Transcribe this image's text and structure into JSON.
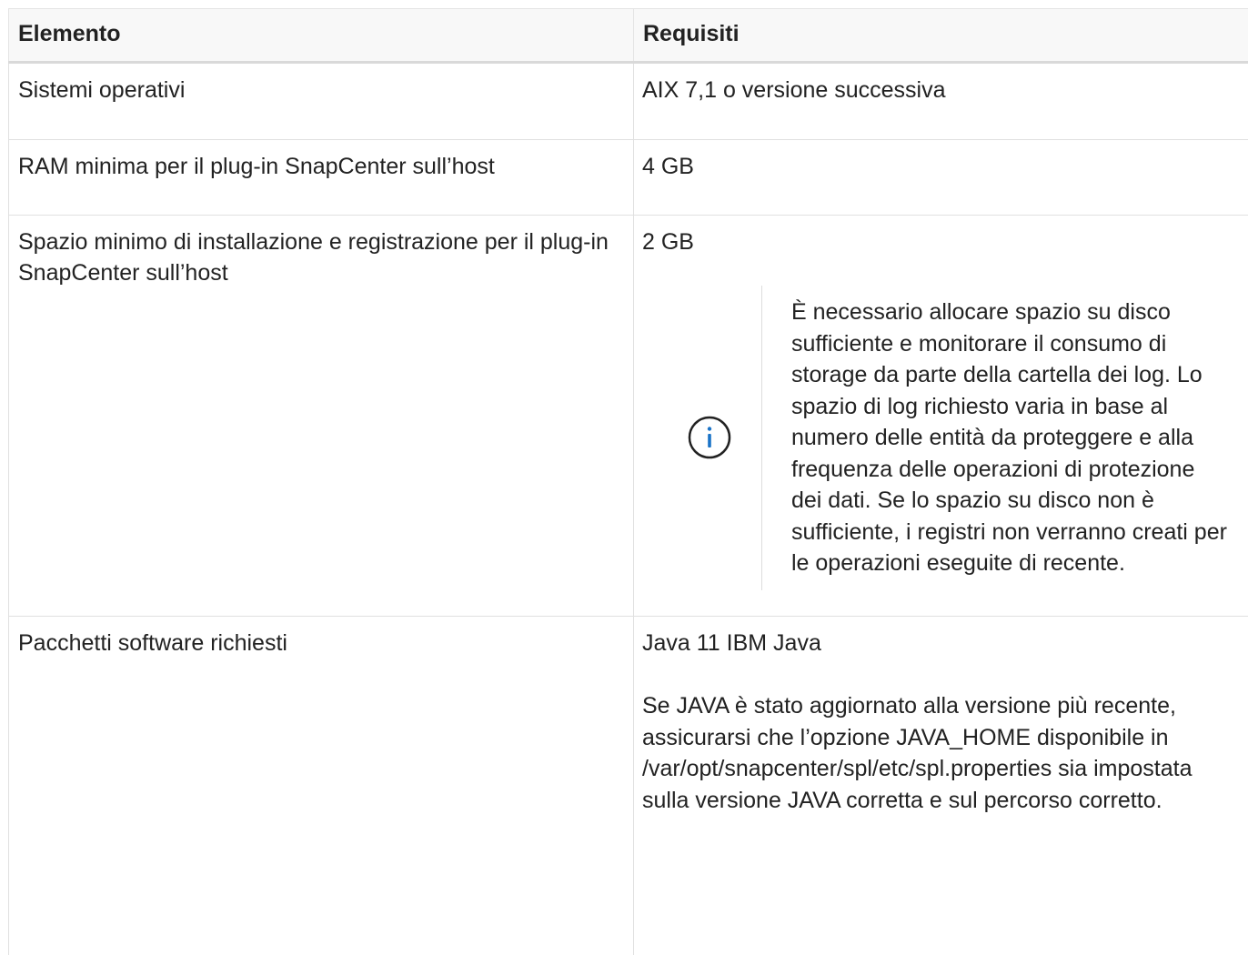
{
  "table": {
    "headers": {
      "col1": "Elemento",
      "col2": "Requisiti"
    },
    "rows": [
      {
        "item": "Sistemi operativi",
        "requirement": "AIX 7,1 o versione successiva"
      },
      {
        "item": "RAM minima per il plug-in SnapCenter sull’host",
        "requirement": "4 GB"
      },
      {
        "item": "Spazio minimo di installazione e registrazione per il plug-in SnapCenter sull’host",
        "requirement": "2 GB",
        "note": "È necessario allocare spazio su disco sufficiente e monitorare il consumo di storage da parte della cartella dei log. Lo spazio di log richiesto varia in base al numero delle entità da proteggere e alla frequenza delle operazioni di protezione dei dati. Se lo spazio su disco non è sufficiente, i registri non verranno creati per le operazioni eseguite di recente."
      },
      {
        "item": "Pacchetti software richiesti",
        "requirement": "Java 11 IBM Java",
        "detail": "Se JAVA è stato aggiornato alla versione più recente, assicurarsi che l’opzione JAVA_HOME disponibile in /var/opt/snapcenter/spl/etc/spl.properties sia impostata sulla versione JAVA corretta e sul percorso corretto."
      }
    ]
  },
  "icons": {
    "note_icon": "info-circle-icon"
  },
  "colors": {
    "text": "#222222",
    "icon": "#1a73c7",
    "header_bg": "#f8f8f8",
    "border": "#e0e0e0"
  }
}
